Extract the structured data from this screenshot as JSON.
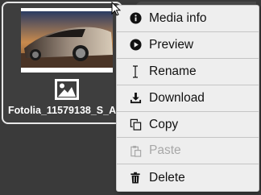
{
  "file": {
    "name": "Fotolia_11579138_S_A"
  },
  "context_menu": {
    "items": [
      {
        "label": "Media info",
        "icon": "info-icon"
      },
      {
        "label": "Preview",
        "icon": "play-icon"
      },
      {
        "label": "Rename",
        "icon": "text-cursor-icon"
      },
      {
        "label": "Download",
        "icon": "download-icon"
      },
      {
        "label": "Copy",
        "icon": "copy-icon"
      },
      {
        "label": "Paste",
        "icon": "paste-icon",
        "disabled": true
      },
      {
        "label": "Delete",
        "icon": "trash-icon"
      }
    ]
  },
  "colors": {
    "menu_bg": "#eeeeee",
    "disabled_text": "#a8a8a8",
    "page_bg": "#3a3a3a"
  }
}
